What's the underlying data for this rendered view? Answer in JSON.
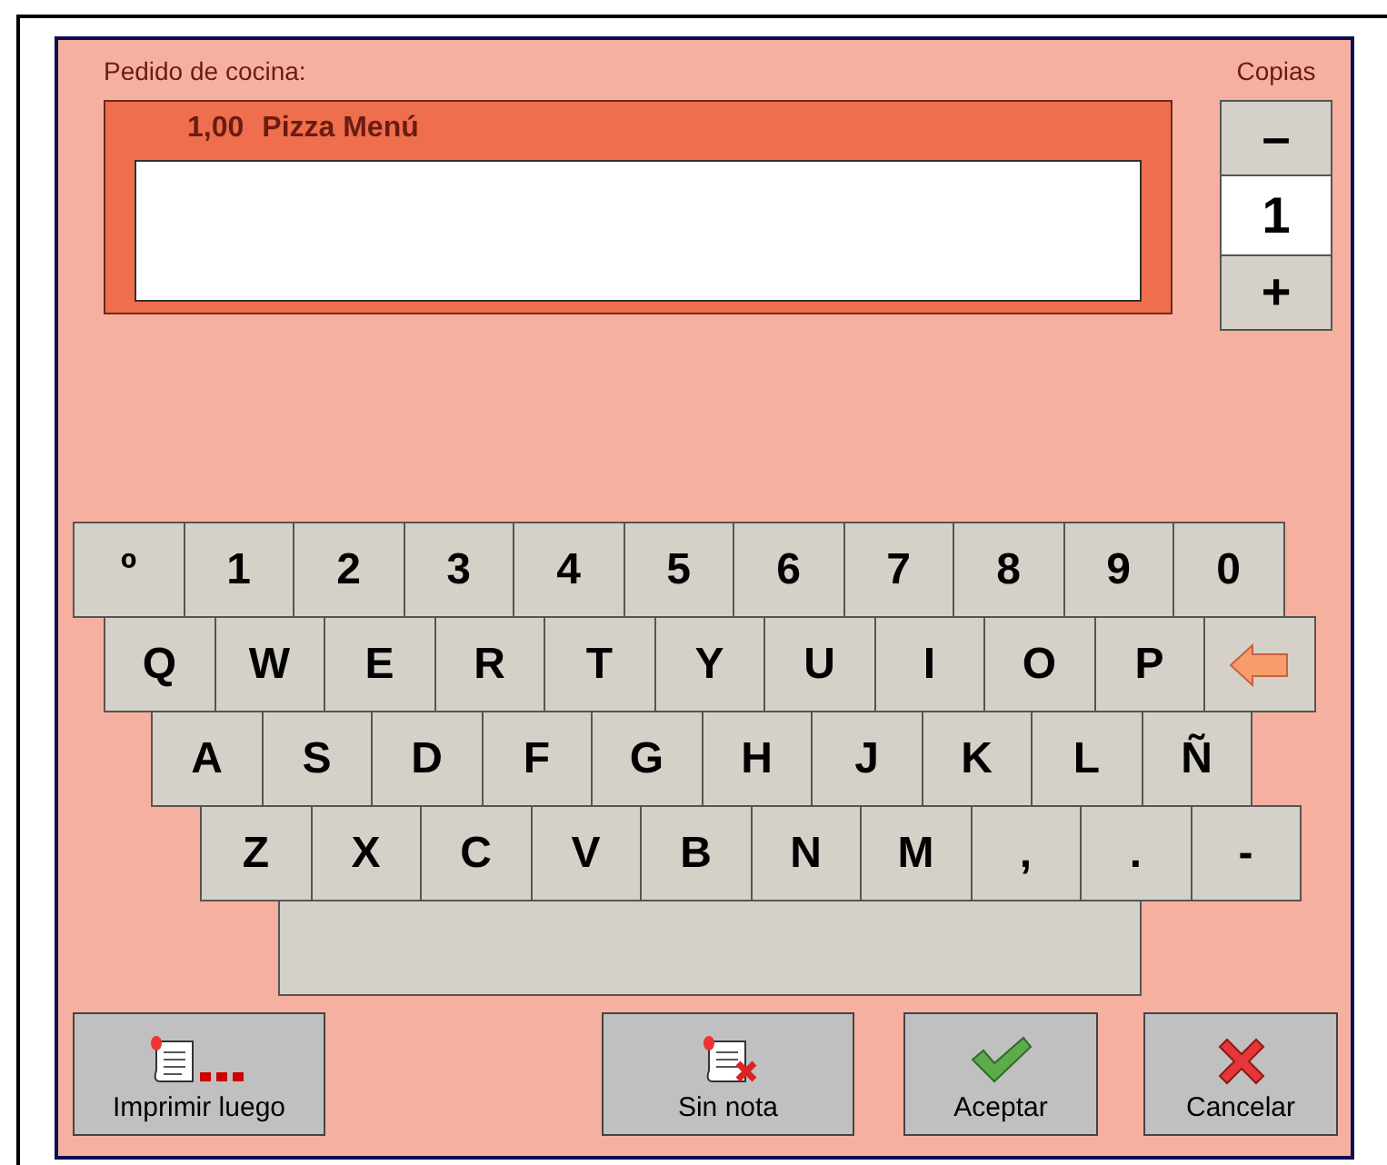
{
  "order": {
    "label": "Pedido de cocina:",
    "quantity": "1,00",
    "item": "Pizza Menú"
  },
  "copies": {
    "label": "Copias",
    "minus": "–",
    "value": "1",
    "plus": "+"
  },
  "keyboard": {
    "rows": [
      [
        {
          "kind": "key",
          "label": "º"
        },
        {
          "kind": "key",
          "label": "1"
        },
        {
          "kind": "key",
          "label": "2"
        },
        {
          "kind": "key",
          "label": "3"
        },
        {
          "kind": "key",
          "label": "4"
        },
        {
          "kind": "key",
          "label": "5"
        },
        {
          "kind": "key",
          "label": "6"
        },
        {
          "kind": "key",
          "label": "7"
        },
        {
          "kind": "key",
          "label": "8"
        },
        {
          "kind": "key",
          "label": "9"
        },
        {
          "kind": "key",
          "label": "0"
        }
      ],
      [
        {
          "kind": "key",
          "label": "Q"
        },
        {
          "kind": "key",
          "label": "W"
        },
        {
          "kind": "key",
          "label": "E"
        },
        {
          "kind": "key",
          "label": "R"
        },
        {
          "kind": "key",
          "label": "T"
        },
        {
          "kind": "key",
          "label": "Y"
        },
        {
          "kind": "key",
          "label": "U"
        },
        {
          "kind": "key",
          "label": "I"
        },
        {
          "kind": "key",
          "label": "O"
        },
        {
          "kind": "key",
          "label": "P"
        },
        {
          "kind": "backspace"
        }
      ],
      [
        {
          "kind": "key",
          "label": "A"
        },
        {
          "kind": "key",
          "label": "S"
        },
        {
          "kind": "key",
          "label": "D"
        },
        {
          "kind": "key",
          "label": "F"
        },
        {
          "kind": "key",
          "label": "G"
        },
        {
          "kind": "key",
          "label": "H"
        },
        {
          "kind": "key",
          "label": "J"
        },
        {
          "kind": "key",
          "label": "K"
        },
        {
          "kind": "key",
          "label": "L"
        },
        {
          "kind": "key",
          "label": "Ñ"
        }
      ],
      [
        {
          "kind": "key",
          "label": "Z"
        },
        {
          "kind": "key",
          "label": "X"
        },
        {
          "kind": "key",
          "label": "C"
        },
        {
          "kind": "key",
          "label": "V"
        },
        {
          "kind": "key",
          "label": "B"
        },
        {
          "kind": "key",
          "label": "N"
        },
        {
          "kind": "key",
          "label": "M"
        },
        {
          "kind": "key",
          "label": ","
        },
        {
          "kind": "key",
          "label": "."
        },
        {
          "kind": "key",
          "label": "-"
        }
      ],
      [
        {
          "kind": "space"
        }
      ]
    ]
  },
  "buttons": [
    {
      "kind": "print-later",
      "label": "Imprimir luego"
    },
    {
      "kind": "no-note",
      "label": "Sin nota"
    },
    {
      "kind": "accept",
      "label": "Aceptar"
    },
    {
      "kind": "cancel",
      "label": "Cancelar"
    }
  ]
}
